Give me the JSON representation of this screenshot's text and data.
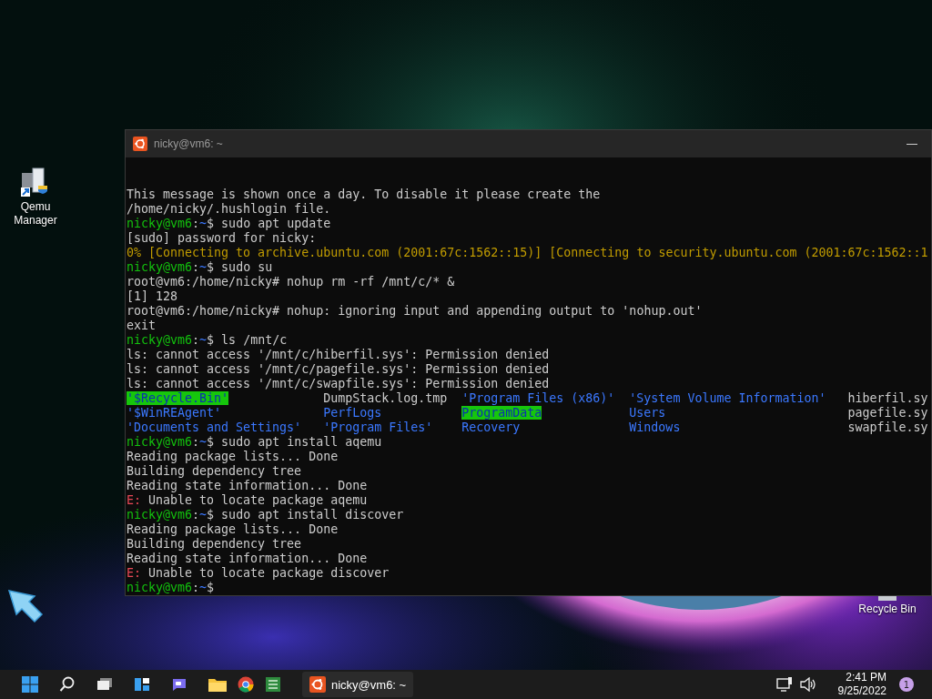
{
  "desktop_icons": [
    {
      "label": "Qemu Manager",
      "kind": "monitor"
    },
    {
      "label": "Recycle Bin",
      "kind": "bin"
    },
    {
      "kind": "arrow"
    }
  ],
  "terminal": {
    "title": "nicky@vm6: ~",
    "lines": [
      {
        "kind": "text",
        "text": "This message is shown once a day. To disable it please create the"
      },
      {
        "kind": "text",
        "text": "/home/nicky/.hushlogin file."
      },
      {
        "kind": "prompt",
        "user": "nicky@vm6",
        "sep": ":",
        "path": "~",
        "sigil": "$",
        "command": "sudo apt update"
      },
      {
        "kind": "text",
        "text": "[sudo] password for nicky:"
      },
      {
        "kind": "progress",
        "text": "0% [Connecting to archive.ubuntu.com (2001:67c:1562::15)] [Connecting to security.ubuntu.com (2001:67c:1562::1"
      },
      {
        "kind": "prompt",
        "user": "nicky@vm6",
        "sep": ":",
        "path": "~",
        "sigil": "$",
        "command": "sudo su"
      },
      {
        "kind": "text",
        "text": "root@vm6:/home/nicky# nohup rm -rf /mnt/c/* &"
      },
      {
        "kind": "text",
        "text": "[1] 128"
      },
      {
        "kind": "text",
        "text": "root@vm6:/home/nicky# nohup: ignoring input and appending output to 'nohup.out'"
      },
      {
        "kind": "text",
        "text": "exit"
      },
      {
        "kind": "prompt",
        "user": "nicky@vm6",
        "sep": ":",
        "path": "~",
        "sigil": "$",
        "command": "ls /mnt/c"
      },
      {
        "kind": "text",
        "text": "ls: cannot access '/mnt/c/hiberfil.sys': Permission denied"
      },
      {
        "kind": "text",
        "text": "ls: cannot access '/mnt/c/pagefile.sys': Permission denied"
      },
      {
        "kind": "text",
        "text": "ls: cannot access '/mnt/c/swapfile.sys': Permission denied"
      },
      {
        "kind": "listing",
        "cells": [
          {
            "text": "'$Recycle.Bin'",
            "kind": "sticky"
          },
          {
            "text": "DumpStack.log.tmp",
            "kind": "file"
          },
          {
            "text": "'Program Files (x86)'",
            "kind": "dir"
          },
          {
            "text": "'System Volume Information'",
            "kind": "dir"
          },
          {
            "text": "hiberfil.sy",
            "kind": "file"
          }
        ]
      },
      {
        "kind": "listing",
        "cells": [
          {
            "text": "'$WinREAgent'",
            "kind": "dir"
          },
          {
            "text": "PerfLogs",
            "kind": "dir"
          },
          {
            "text": "ProgramData",
            "kind": "sticky"
          },
          {
            "text": "Users",
            "kind": "dir"
          },
          {
            "text": "pagefile.sy",
            "kind": "file"
          }
        ]
      },
      {
        "kind": "listing",
        "cells": [
          {
            "text": "'Documents and Settings'",
            "kind": "dir"
          },
          {
            "text": "'Program Files'",
            "kind": "dir"
          },
          {
            "text": "Recovery",
            "kind": "dir"
          },
          {
            "text": "Windows",
            "kind": "dir"
          },
          {
            "text": "swapfile.sy",
            "kind": "file"
          }
        ]
      },
      {
        "kind": "prompt",
        "user": "nicky@vm6",
        "sep": ":",
        "path": "~",
        "sigil": "$",
        "command": "sudo apt install aqemu"
      },
      {
        "kind": "text",
        "text": "Reading package lists... Done"
      },
      {
        "kind": "text",
        "text": "Building dependency tree"
      },
      {
        "kind": "text",
        "text": "Reading state information... Done"
      },
      {
        "kind": "error",
        "marker": "E:",
        "text": "Unable to locate package aqemu"
      },
      {
        "kind": "prompt",
        "user": "nicky@vm6",
        "sep": ":",
        "path": "~",
        "sigil": "$",
        "command": "sudo apt install discover"
      },
      {
        "kind": "text",
        "text": "Reading package lists... Done"
      },
      {
        "kind": "text",
        "text": "Building dependency tree"
      },
      {
        "kind": "text",
        "text": "Reading state information... Done"
      },
      {
        "kind": "error",
        "marker": "E:",
        "text": "Unable to locate package discover"
      },
      {
        "kind": "prompt",
        "user": "nicky@vm6",
        "sep": ":",
        "path": "~",
        "sigil": "$"
      }
    ]
  },
  "taskbar": {
    "app_button": {
      "label": "nicky@vm6: ~"
    },
    "clock": {
      "time": "2:41 PM",
      "date": "9/25/2022"
    },
    "notification_count": "1"
  }
}
